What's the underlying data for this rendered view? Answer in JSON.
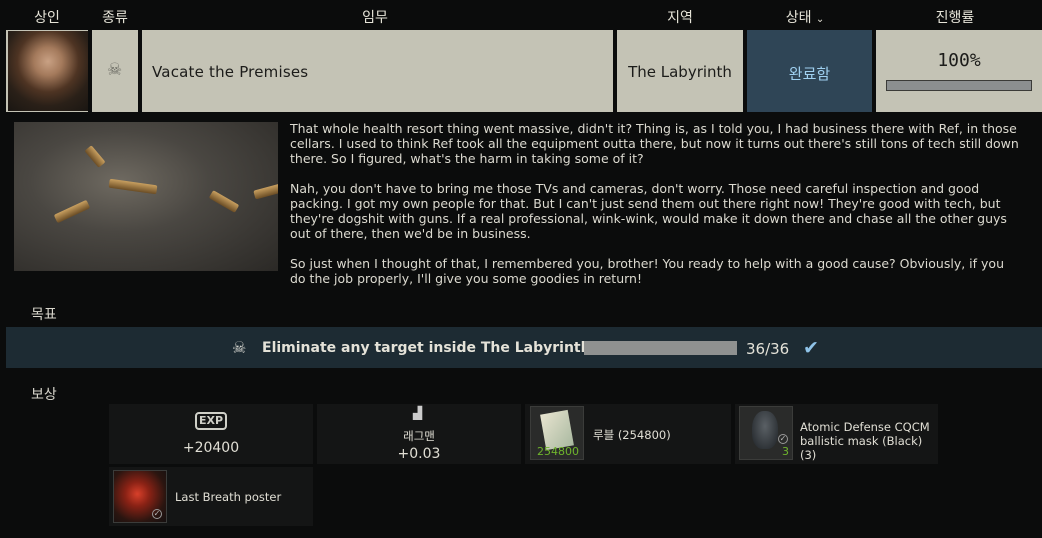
{
  "header": {
    "trader": "상인",
    "type": "종류",
    "quest": "임무",
    "location": "지역",
    "status": "상태",
    "progress": "진행률"
  },
  "quest": {
    "name": "Vacate the Premises",
    "location": "The Labyrinth",
    "status": "완료함",
    "progress_label": "100%",
    "progress_fraction": 1.0
  },
  "description": {
    "paragraphs": [
      "That whole health resort thing went massive, didn't it? Thing is, as I told you, I had business there with Ref, in those cellars. I used to think Ref took all the equipment outta there, but now it turns out there's still tons of tech still down there. So I figured, what's the harm in taking some of it?",
      "Nah, you don't have to bring me those TVs and cameras, don't worry. Those need careful inspection and good packing. I got my own people for that. But I can't just send them out there right now! They're good with tech, but they're dogshit with guns. If a real professional, wink-wink, would make it down there and chase all the other guys out of there, then we'd be in business.",
      "So just when I thought of that, I remembered you, brother! You ready to help with a good cause? Obviously, if you do the job properly, I'll give you some goodies in return!"
    ]
  },
  "objectives": {
    "label": "목표",
    "items": [
      {
        "text": "Eliminate any target inside The Labyrinth",
        "count": "36/36",
        "fraction": 1.0
      }
    ]
  },
  "rewards": {
    "label": "보상",
    "exp": {
      "icon_text": "EXP",
      "value": "+20400"
    },
    "rep": {
      "name": "래그맨",
      "value": "+0.03"
    },
    "roubles": {
      "name": "루블  (254800)",
      "qty": "254800"
    },
    "mask": {
      "name": "Atomic Defense CQCM ballistic mask (Black) (3)",
      "qty": "3"
    },
    "poster": {
      "name": "Last Breath poster"
    }
  },
  "colors": {
    "row_bg": "#c4c3b5",
    "status_bg": "#2f4556",
    "status_text": "#9fd0f0",
    "objective_bg": "#1d2b33",
    "check": "#8fc3e8",
    "qty_green": "#6fb52c"
  }
}
